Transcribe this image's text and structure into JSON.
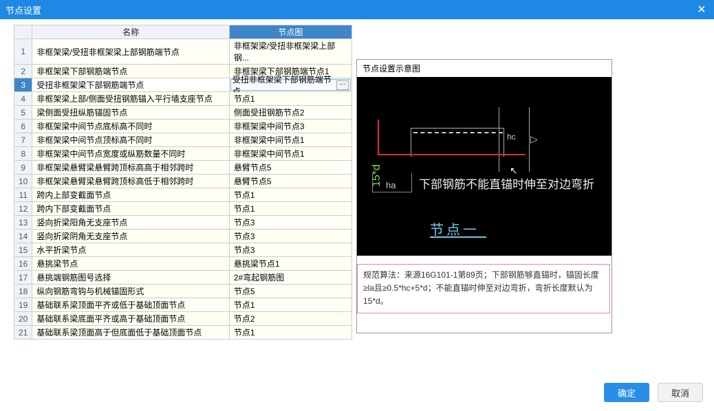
{
  "window": {
    "title": "节点设置"
  },
  "table": {
    "headers": {
      "name": "名称",
      "diagram": "节点图"
    },
    "rows": [
      {
        "idx": "1",
        "name": "非框架梁/受扭非框架梁上部钢筋端节点",
        "diagram": "非框架梁/受扭非框架梁上部钢..."
      },
      {
        "idx": "2",
        "name": "非框架梁下部钢筋端节点",
        "diagram": "非框架梁下部钢筋端节点1"
      },
      {
        "idx": "3",
        "name": "受扭非框架梁下部钢筋端节点",
        "diagram": "受扭非框架梁下部钢筋端节点"
      },
      {
        "idx": "4",
        "name": "非框架梁上部/侧面受扭钢筋锚入平行墙支座节点",
        "diagram": "节点1"
      },
      {
        "idx": "5",
        "name": "梁侧面受扭纵筋锚固节点",
        "diagram": "侧面受扭钢筋节点2"
      },
      {
        "idx": "6",
        "name": "非框架梁中间节点底标高不同时",
        "diagram": "非框架梁中间节点3"
      },
      {
        "idx": "7",
        "name": "非框架梁中间节点顶标高不同时",
        "diagram": "非框架梁中间节点1"
      },
      {
        "idx": "8",
        "name": "非框架梁中间节点宽度或纵筋数量不同时",
        "diagram": "非框架梁中间节点1"
      },
      {
        "idx": "9",
        "name": "非框架梁悬臂梁悬臂跨顶标高高于相邻跨时",
        "diagram": "悬臂节点5"
      },
      {
        "idx": "10",
        "name": "非框架梁悬臂梁悬臂跨顶标高低于相邻跨时",
        "diagram": "悬臂节点5"
      },
      {
        "idx": "11",
        "name": "跨内上部变截面节点",
        "diagram": "节点1"
      },
      {
        "idx": "12",
        "name": "跨内下部变截面节点",
        "diagram": "节点1"
      },
      {
        "idx": "13",
        "name": "竖向折梁阳角无支座节点",
        "diagram": "节点3"
      },
      {
        "idx": "14",
        "name": "竖向折梁阴角无支座节点",
        "diagram": "节点3"
      },
      {
        "idx": "15",
        "name": "水平折梁节点",
        "diagram": "节点3"
      },
      {
        "idx": "16",
        "name": "悬挑梁节点",
        "diagram": "悬挑梁节点1"
      },
      {
        "idx": "17",
        "name": "悬挑端钢筋图号选择",
        "diagram": "2#弯起钢筋图"
      },
      {
        "idx": "18",
        "name": "纵向钢筋弯钩与机械锚固形式",
        "diagram": "节点5"
      },
      {
        "idx": "19",
        "name": "基础联系梁顶面平齐或低于基础顶面节点",
        "diagram": "节点1"
      },
      {
        "idx": "20",
        "name": "基础联系梁底面平齐或高于基础顶面节点",
        "diagram": "节点2"
      },
      {
        "idx": "21",
        "name": "基础联系梁顶面高于但底面低于基础顶面节点",
        "diagram": "节点1"
      }
    ],
    "selected_index": 2
  },
  "preview": {
    "title": "节点设置示意图",
    "labels": {
      "v": "15*d",
      "ha": "ha",
      "hc": "hc",
      "text": "下部钢筋不能直锚时伸至对边弯折",
      "diagram_title": "节点一"
    },
    "description": "规范算法：来源16G101-1第89页；下部钢筋够直锚时，锚固长度≥la且≥0.5*hc+5*d；不能直锚时伸至对边弯折，弯折长度默认为15*d。"
  },
  "footer": {
    "ok": "确定",
    "cancel": "取消"
  },
  "misc": {
    "ellipsis": "···"
  }
}
